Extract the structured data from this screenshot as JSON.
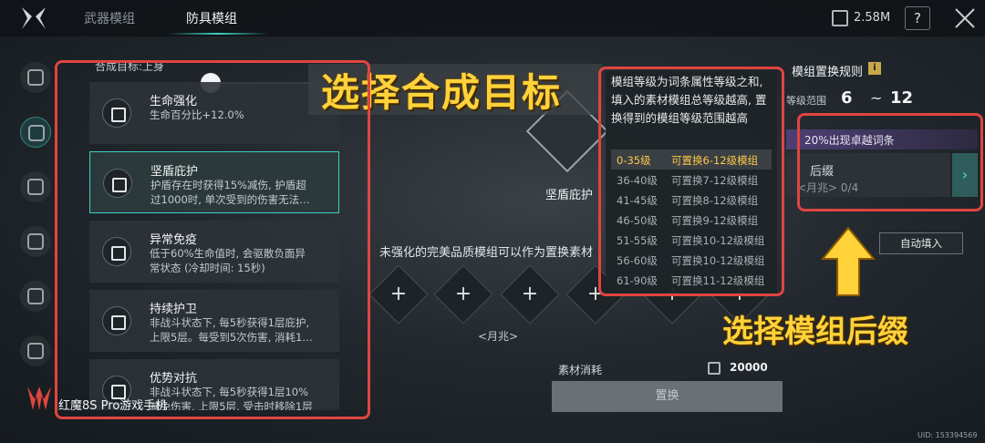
{
  "tabs": [
    {
      "label": "武器模组",
      "active": false
    },
    {
      "label": "防具模组",
      "active": true
    }
  ],
  "currency": {
    "value": "2.58M"
  },
  "help_label": "?",
  "target_label": "合成目标:上身",
  "mods": [
    {
      "title": "生命强化",
      "desc": "生命百分比+12.0%"
    },
    {
      "title": "坚盾庇护",
      "desc": "护盾存在时获得15%减伤, 护盾超\n过1000时, 单次受到的伤害无法…"
    },
    {
      "title": "异常免疫",
      "desc": "低于60%生命值时, 会驱散负面异\n常状态 (冷却时间: 15秒)"
    },
    {
      "title": "持续护卫",
      "desc": "非战斗状态下, 每5秒获得1层庇护,\n上限5层。每受到5次伤害, 消耗1…"
    },
    {
      "title": "优势对抗",
      "desc": "非战斗状态下, 每5秒获得1层10%\n减免伤害, 上限5层, 受击时移除1层"
    }
  ],
  "overlay_title": "选择合成目标",
  "center": {
    "name": "坚盾庇护",
    "hint": "未强化的完美品质模组可以作为置换素材",
    "slots": [
      "+",
      "+",
      "+",
      "+",
      "+",
      "+"
    ],
    "moon_label": "<月兆>",
    "cost_label": "素材消耗",
    "cost_value": "20000",
    "swap_label": "置换"
  },
  "info_popup": {
    "text": "模组等级为词条属性等级之和, 填入的素材模组总等级越高, 置换得到的模组等级范围越高",
    "tiers": [
      {
        "level": "0-35级",
        "result": "可置换6-12级模组",
        "highlight": true
      },
      {
        "level": "36-40级",
        "result": "可置换7-12级模组",
        "highlight": false
      },
      {
        "level": "41-45级",
        "result": "可置换8-12级模组",
        "highlight": false
      },
      {
        "level": "46-50级",
        "result": "可置换9-12级模组",
        "highlight": false
      },
      {
        "level": "51-55级",
        "result": "可置换10-12级模组",
        "highlight": false
      },
      {
        "level": "56-60级",
        "result": "可置换10-12级模组",
        "highlight": false
      },
      {
        "level": "61-90级",
        "result": "可置换11-12级模组",
        "highlight": false
      }
    ]
  },
  "rules": {
    "title": "模组置换规则",
    "info_icon": "i",
    "range_label": "等级范围",
    "range_min": "6",
    "range_sep": "~",
    "range_max": "12",
    "chance_text": "20%出现卓越词条",
    "suffix_label": "后缀",
    "suffix_sub": "<月兆> 0/4",
    "suffix_arrow": "›",
    "autofill_label": "自动填入"
  },
  "overlay_suffix": "选择模组后缀",
  "watermark": "红魔8S Pro游戏手机",
  "uid": "UID: 153394569",
  "colors": {
    "accent": "#3fd1c4",
    "annotation_red": "#e0453f",
    "overlay_yellow": "#ffd23a"
  }
}
